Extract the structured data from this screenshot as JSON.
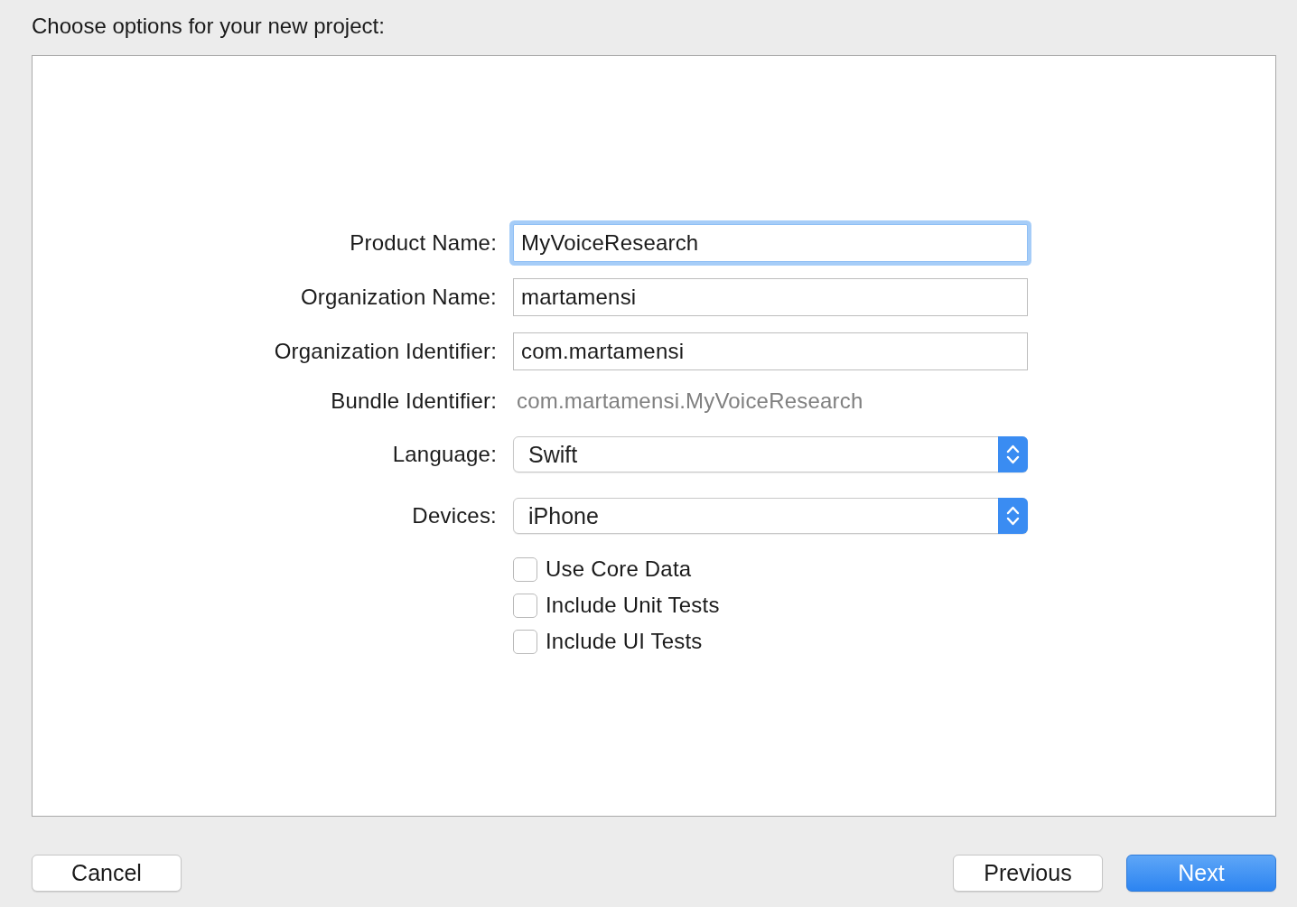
{
  "heading": "Choose options for your new project:",
  "fields": [
    {
      "kind": "text",
      "label": "Product Name:",
      "value": "MyVoiceResearch",
      "focused": true
    },
    {
      "kind": "text",
      "label": "Organization Name:",
      "value": "martamensi",
      "focused": false
    },
    {
      "kind": "text",
      "label": "Organization Identifier:",
      "value": "com.martamensi",
      "focused": false
    },
    {
      "kind": "static",
      "label": "Bundle Identifier:",
      "value": "com.martamensi.MyVoiceResearch"
    },
    {
      "kind": "popup",
      "label": "Language:",
      "value": "Swift"
    },
    {
      "kind": "popup",
      "label": "Devices:",
      "value": "iPhone"
    }
  ],
  "options": [
    {
      "label": "Use Core Data",
      "checked": false
    },
    {
      "label": "Include Unit Tests",
      "checked": false
    },
    {
      "label": "Include UI Tests",
      "checked": false
    }
  ],
  "buttons": [
    {
      "label": "Cancel",
      "default": false
    },
    {
      "label": "Previous",
      "default": false
    },
    {
      "label": "Next",
      "default": true
    }
  ]
}
